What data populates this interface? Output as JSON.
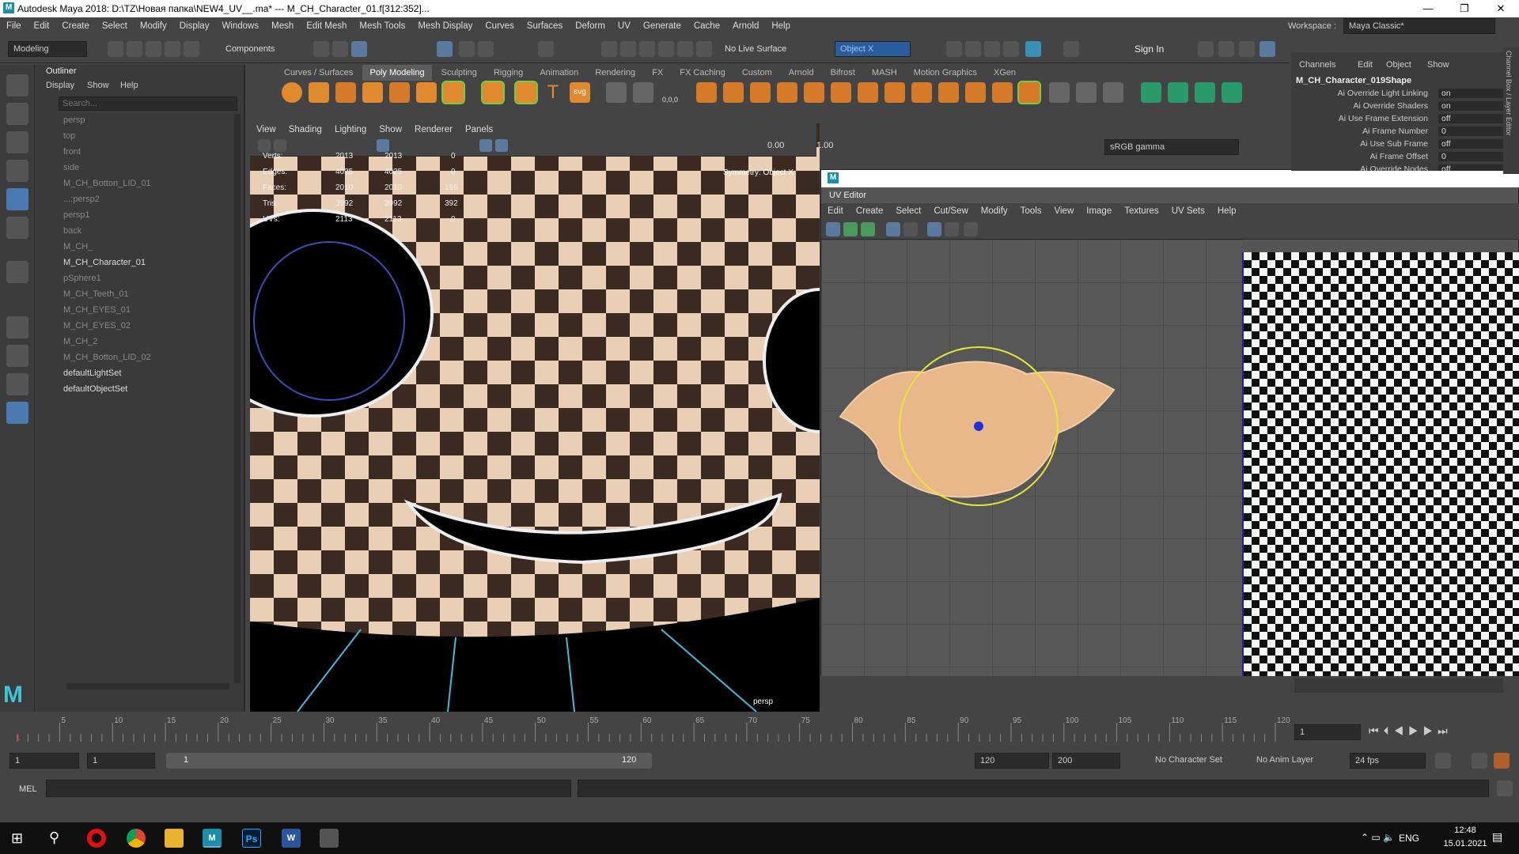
{
  "window": {
    "title": "Autodesk Maya 2018: D:\\TZ\\Новая папка\\NEW4_UV__.ma*  ---  M_CH_Character_01.f[312:352]...",
    "logo": "M",
    "minimize": "—",
    "maximize": "❐",
    "close": "✕"
  },
  "menubar": {
    "items": [
      "File",
      "Edit",
      "Create",
      "Select",
      "Modify",
      "Display",
      "Windows",
      "Mesh",
      "Edit Mesh",
      "Mesh Tools",
      "Mesh Display",
      "Curves",
      "Surfaces",
      "Deform",
      "UV",
      "Generate",
      "Cache",
      "Arnold",
      "Help"
    ],
    "workspace_label": "Workspace :",
    "workspace_value": "Maya Classic*"
  },
  "statusline": {
    "mode": "Modeling",
    "components_label": "Components",
    "live_surface": "No Live Surface",
    "symmetry": "Object X",
    "sign_in": "Sign In"
  },
  "shelf": {
    "tabs": [
      "Curves / Surfaces",
      "Poly Modeling",
      "Sculpting",
      "Rigging",
      "Animation",
      "Rendering",
      "FX",
      "FX Caching",
      "Custom",
      "Arnold",
      "Bifrost",
      "MASH",
      "Motion Graphics",
      "XGen"
    ],
    "active": "Poly Modeling",
    "text_icon": "T",
    "svg_icon": "svg",
    "coord_icon": "0,0,0"
  },
  "outliner": {
    "title": "Outliner",
    "menu": [
      "Display",
      "Show",
      "Help"
    ],
    "search_placeholder": "Search...",
    "items": [
      "persp",
      "top",
      "front",
      "side",
      "M_CH_Botton_LID_01",
      "...:persp2",
      "persp1",
      "back",
      "M_CH_",
      "M_CH_Character_01",
      "pSphere1",
      "M_CH_Teeth_01",
      "M_CH_EYES_01",
      "M_CH_EYES_02",
      "M_CH_2",
      "M_CH_Botton_LID_02",
      "defaultLightSet",
      "defaultObjectSet"
    ]
  },
  "viewport": {
    "menu": [
      "View",
      "Shading",
      "Lighting",
      "Show",
      "Renderer",
      "Panels"
    ],
    "exposure": "0.00",
    "gamma": "1.00",
    "colorspace": "sRGB gamma",
    "camera_label": "persp",
    "symmetry_label": "Symmetry: Object X",
    "hud": [
      {
        "label": "Verts:",
        "a": "2013",
        "b": "2013",
        "c": "0"
      },
      {
        "label": "Edges:",
        "a": "4025",
        "b": "4025",
        "c": "0"
      },
      {
        "label": "Faces:",
        "a": "2010",
        "b": "2010",
        "c": "196"
      },
      {
        "label": "Tris:",
        "a": "3992",
        "b": "3992",
        "c": "392"
      },
      {
        "label": "UVs:",
        "a": "2113",
        "b": "2113",
        "c": "0"
      }
    ]
  },
  "uv_editor": {
    "logo": "M",
    "title": "UV Editor",
    "menu": [
      "Edit",
      "Create",
      "Select",
      "Cut/Sew",
      "Modify",
      "Tools",
      "View",
      "Image",
      "Textures",
      "UV Sets",
      "Help"
    ]
  },
  "channel_box": {
    "menu": [
      "Channels",
      "Edit",
      "Object",
      "Show"
    ],
    "object": "M_CH_Character_019Shape",
    "rows": [
      {
        "k": "Ai Override Light Linking",
        "v": "on"
      },
      {
        "k": "Ai Override Shaders",
        "v": "on"
      },
      {
        "k": "Ai Use Frame Extension",
        "v": "off"
      },
      {
        "k": "Ai Frame Number",
        "v": "0"
      },
      {
        "k": "Ai Use Sub Frame",
        "v": "off"
      },
      {
        "k": "Ai Frame Offset",
        "v": "0"
      },
      {
        "k": "Ai Override Nodes",
        "v": "off"
      }
    ],
    "side_tab": "Channel Box / Layer Editor"
  },
  "timeline": {
    "ticks": [
      "5",
      "10",
      "15",
      "20",
      "25",
      "30",
      "35",
      "40",
      "45",
      "50",
      "55",
      "60",
      "65",
      "70",
      "75",
      "80",
      "85",
      "90",
      "95",
      "100",
      "105",
      "110",
      "115",
      "120"
    ],
    "current_frame_marker": "1",
    "current_frame": "1"
  },
  "range": {
    "start": "1",
    "playback_start": "1",
    "slider_start": "1",
    "slider_end": "120",
    "playback_end": "120",
    "end": "200",
    "character_set": "No Character Set",
    "anim_layer": "No Anim Layer",
    "fps": "24 fps"
  },
  "cmdline": {
    "label": "MEL"
  },
  "taskbar": {
    "lang": "ENG",
    "time": "12:48",
    "date": "15.01.2021",
    "ps_label": "Ps",
    "word_label": "W",
    "maya_label": "M"
  }
}
